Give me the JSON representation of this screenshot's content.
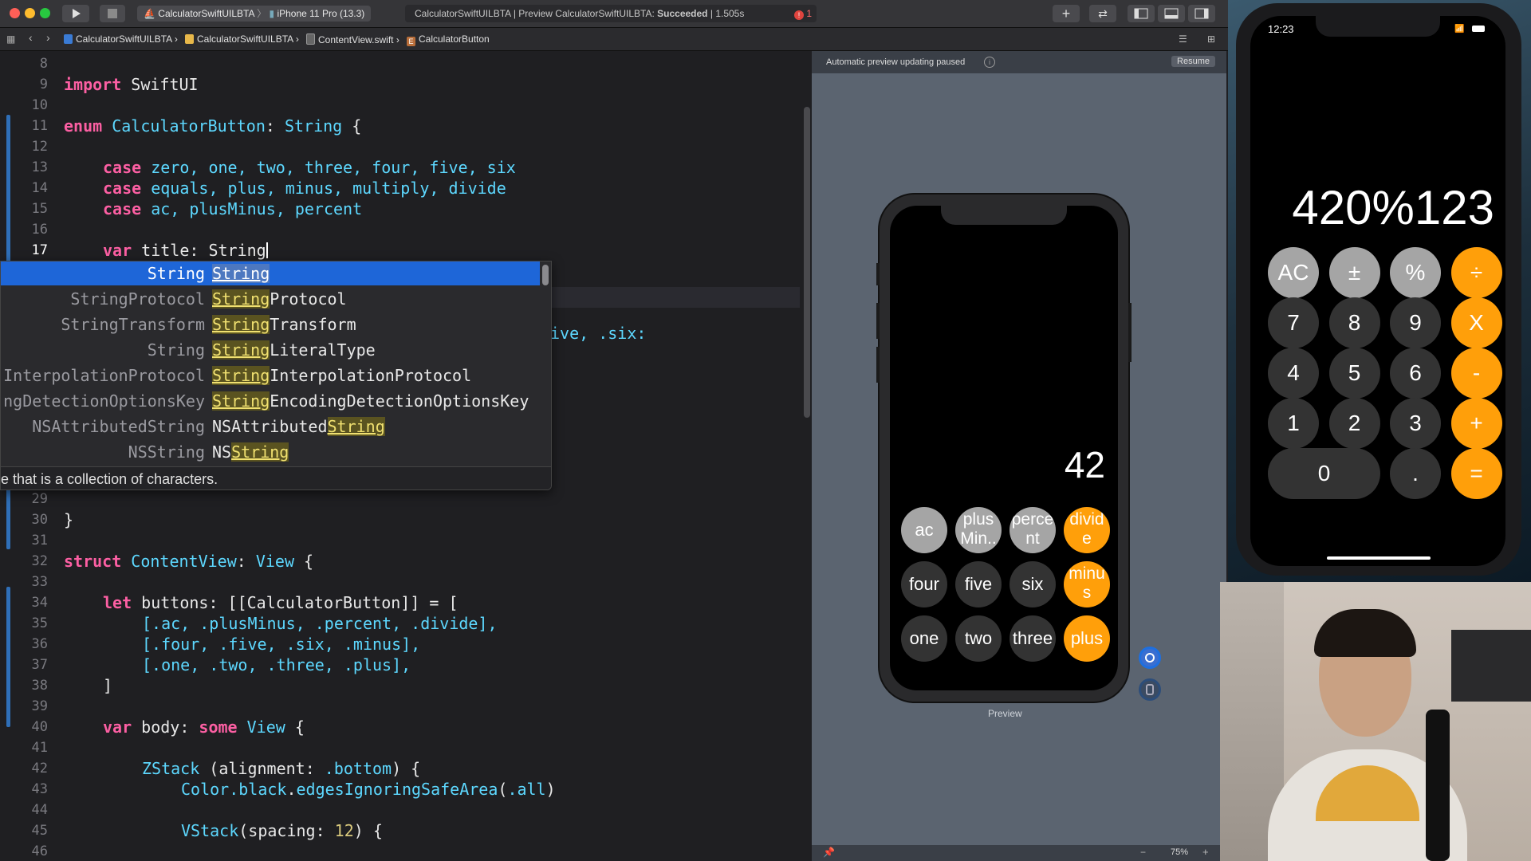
{
  "toolbar": {
    "scheme_name": "CalculatorSwiftUILBTA",
    "device_name": "iPhone 11 Pro (13.3)",
    "status_project": "CalculatorSwiftUILBTA",
    "status_text": "Preview CalculatorSwiftUILBTA: ",
    "status_result": "Succeeded",
    "status_time": "1.505s",
    "error_count": "1"
  },
  "jumpbar": {
    "project": "CalculatorSwiftUILBTA",
    "folder": "CalculatorSwiftUILBTA",
    "file": "ContentView.swift",
    "symbol": "CalculatorButton"
  },
  "editor": {
    "line_numbers_top": [
      "8",
      "9",
      "10",
      "11",
      "12",
      "13",
      "14",
      "15",
      "16",
      "17"
    ],
    "line_numbers_bottom": [
      "29",
      "30",
      "31",
      "32",
      "33",
      "34",
      "35",
      "36",
      "37",
      "38",
      "39",
      "40",
      "41",
      "42",
      "43",
      "44",
      "45",
      "46"
    ],
    "line_9": {
      "kw": "import",
      "rest": " SwiftUI"
    },
    "line_11": {
      "kw": "enum",
      "ty": "CalculatorButton",
      "rest1": ": ",
      "ty2": "String",
      "rest2": " {"
    },
    "line_13": {
      "kw": "case",
      "cases": " zero, one, two, three, four, five, six"
    },
    "line_14": {
      "kw": "case",
      "cases": " equals, plus, minus, multiply, divide"
    },
    "line_15": {
      "kw": "case",
      "cases": " ac, plusMinus, percent"
    },
    "line_17": {
      "kw": "var",
      "rest": " title: ",
      "ty": "String"
    },
    "partial_line": "ive, .six:",
    "line_30": "}",
    "line_32": {
      "kw": "struct",
      "ty": "ContentView",
      "rest": ": ",
      "ty2": "View",
      "rest2": " {"
    },
    "line_34": {
      "kw": "let",
      "rest": " buttons: [[",
      "ty": "CalculatorButton",
      "rest2": "]] = ["
    },
    "line_35": "[.ac, .plusMinus, .percent, .divide],",
    "line_36": "[.four, .five, .six, .minus],",
    "line_37": "[.one, .two, .three, .plus],",
    "line_38": "]",
    "line_40": {
      "kw": "var",
      "rest": " body: ",
      "kw2": "some",
      "ty": "View",
      "rest2": " {"
    },
    "line_42": {
      "ty": "ZStack",
      "rest": " (alignment: ",
      "fn": ".bottom",
      "rest2": ") {"
    },
    "line_43": {
      "ty": "Color",
      "fn": ".black",
      "rest": ".",
      "fn2": "edgesIgnoringSafeArea",
      "rest2": "(",
      "fn3": ".all",
      "rest3": ")"
    },
    "line_45": {
      "ty": "VStack",
      "rest": "(spacing: ",
      "num": "12",
      "rest2": ") {"
    }
  },
  "autocomplete": {
    "items": [
      {
        "type": "String",
        "match": "String",
        "suffix": "",
        "prefix": ""
      },
      {
        "type": "StringProtocol",
        "match": "String",
        "suffix": "Protocol",
        "prefix": ""
      },
      {
        "type": "StringTransform",
        "match": "String",
        "suffix": "Transform",
        "prefix": ""
      },
      {
        "type": "String",
        "match": "String",
        "suffix": "LiteralType",
        "prefix": ""
      },
      {
        "type": "InterpolationProtocol",
        "match": "String",
        "suffix": "InterpolationProtocol",
        "prefix": ""
      },
      {
        "type": "ngDetectionOptionsKey",
        "match": "String",
        "suffix": "EncodingDetectionOptionsKey",
        "prefix": ""
      },
      {
        "type": "NSAttributedString",
        "match": "String",
        "suffix": "",
        "prefix": "NSAttributed"
      },
      {
        "type": "NSString",
        "match": "String",
        "suffix": "",
        "prefix": "NS"
      }
    ],
    "description": "e that is a collection of characters."
  },
  "preview": {
    "notice": "Automatic preview updating paused",
    "resume_label": "Resume",
    "caption": "Preview",
    "zoom": "75%",
    "display": "42",
    "rows": [
      [
        {
          "label": "ac",
          "style": "gray"
        },
        {
          "label": "plus Min..",
          "style": "gray"
        },
        {
          "label": "perce nt",
          "style": "gray"
        },
        {
          "label": "divid e",
          "style": "orange"
        }
      ],
      [
        {
          "label": "four",
          "style": "dark"
        },
        {
          "label": "five",
          "style": "dark"
        },
        {
          "label": "six",
          "style": "dark"
        },
        {
          "label": "minu s",
          "style": "orange"
        }
      ],
      [
        {
          "label": "one",
          "style": "dark"
        },
        {
          "label": "two",
          "style": "dark"
        },
        {
          "label": "three",
          "style": "dark"
        },
        {
          "label": "plus",
          "style": "orange"
        }
      ]
    ]
  },
  "simulator": {
    "time": "12:23",
    "display": "420%123",
    "rows": [
      [
        {
          "label": "AC",
          "style": "gray"
        },
        {
          "label": "±",
          "style": "gray"
        },
        {
          "label": "%",
          "style": "gray"
        },
        {
          "label": "÷",
          "style": "orange"
        }
      ],
      [
        {
          "label": "7",
          "style": "dark"
        },
        {
          "label": "8",
          "style": "dark"
        },
        {
          "label": "9",
          "style": "dark"
        },
        {
          "label": "X",
          "style": "orange"
        }
      ],
      [
        {
          "label": "4",
          "style": "dark"
        },
        {
          "label": "5",
          "style": "dark"
        },
        {
          "label": "6",
          "style": "dark"
        },
        {
          "label": "-",
          "style": "orange"
        }
      ],
      [
        {
          "label": "1",
          "style": "dark"
        },
        {
          "label": "2",
          "style": "dark"
        },
        {
          "label": "3",
          "style": "dark"
        },
        {
          "label": "+",
          "style": "orange"
        }
      ],
      [
        {
          "label": "0",
          "style": "dark",
          "wide": true
        },
        {
          "label": ".",
          "style": "dark"
        },
        {
          "label": "=",
          "style": "orange"
        }
      ]
    ]
  },
  "colors": {
    "accent": "#1e66d8",
    "orange": "#ff9f0a",
    "keyword": "#fc5fa3",
    "type": "#5dd8ff"
  }
}
